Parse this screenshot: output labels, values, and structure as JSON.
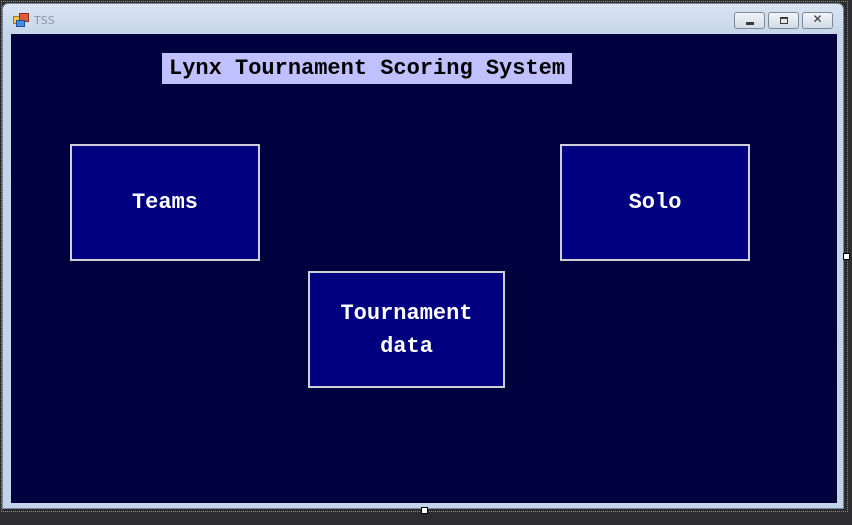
{
  "window": {
    "title": "TSS",
    "icon": "windows-form-icon",
    "caption_buttons": {
      "minimize_icon": "minimize-icon",
      "maximize_icon": "maximize-icon",
      "close_glyph": "✕"
    }
  },
  "form": {
    "title": "Lynx Tournament Scoring System",
    "buttons": {
      "teams_label": "Teams",
      "solo_label": "Solo",
      "tournament_data_label": "Tournament\ndata"
    }
  },
  "colors": {
    "form_background": "#00003f",
    "button_background": "#000080",
    "title_background": "#c0c0ff",
    "button_text": "#ffffff"
  }
}
